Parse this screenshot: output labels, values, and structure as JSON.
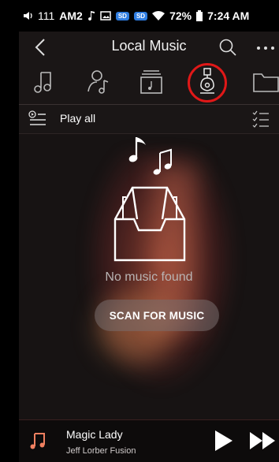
{
  "status_bar": {
    "left_number": "111",
    "am_label": "AM2",
    "sd1": "SD",
    "sd2": "SD",
    "battery": "72%",
    "time": "7:24 AM"
  },
  "header": {
    "title": "Local Music",
    "back_icon": "chevron-left-icon",
    "search_icon": "search-icon",
    "more_icon": "more-icon"
  },
  "tabs": [
    {
      "name": "songs",
      "icon": "music-note-icon"
    },
    {
      "name": "artists",
      "icon": "artist-icon"
    },
    {
      "name": "albums",
      "icon": "album-icon"
    },
    {
      "name": "genres",
      "icon": "guitar-icon",
      "selected": true
    },
    {
      "name": "folders",
      "icon": "folder-icon"
    }
  ],
  "toolbar": {
    "play_all_label": "Play all"
  },
  "empty_state": {
    "message": "No music found",
    "scan_button": "SCAN FOR MUSIC"
  },
  "now_playing": {
    "title": "Magic Lady",
    "artist": "Jeff Lorber Fusion"
  },
  "colors": {
    "accent_red": "#e01818",
    "background": "#171313",
    "note_orange": "#f08060"
  }
}
